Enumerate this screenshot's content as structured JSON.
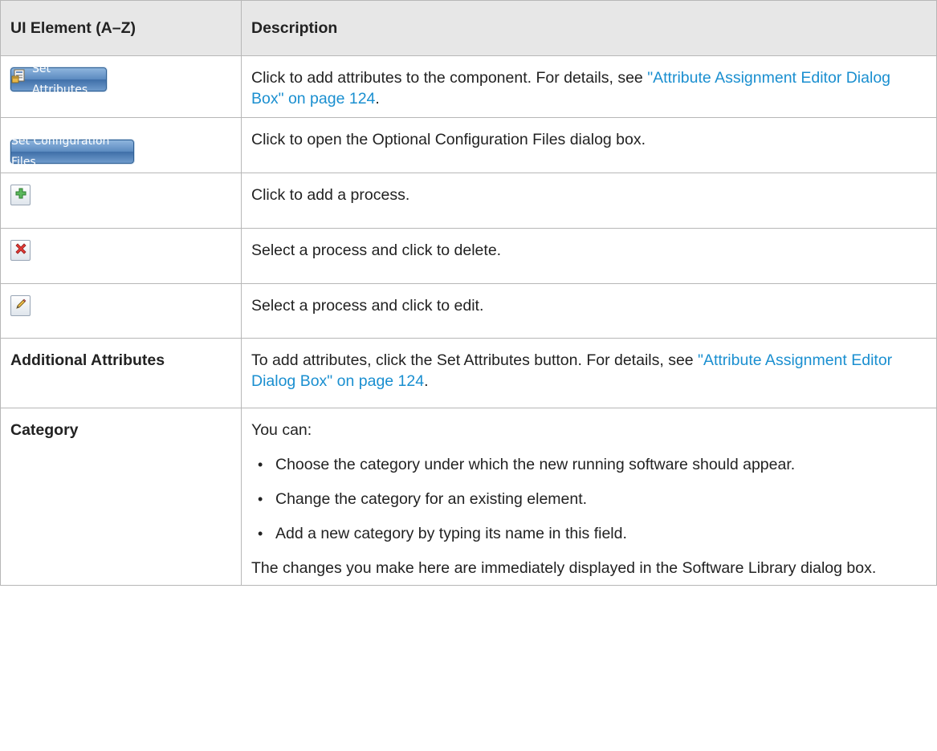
{
  "table": {
    "header": {
      "col1": "UI Element (A–Z)",
      "col2": "Description"
    },
    "rows": {
      "set_attributes": {
        "button_label": "Set Attributes",
        "icon": "set-attributes-icon",
        "desc_prefix": "Click to add attributes to the component. For details, see ",
        "desc_link": "\"Attribute Assignment Editor Dialog Box\" on page 124",
        "desc_suffix": "."
      },
      "set_config": {
        "button_label": "Set Configuration Files",
        "desc": "Click to open the Optional Configuration Files dialog box."
      },
      "add": {
        "icon": "add-plus-icon",
        "desc": "Click to add a process."
      },
      "delete": {
        "icon": "delete-x-icon",
        "desc": "Select a process and click to delete."
      },
      "edit": {
        "icon": "edit-pencil-icon",
        "desc": "Select a process and click to edit."
      },
      "additional": {
        "name": "Additional Attributes",
        "desc_prefix": "To add attributes, click the Set Attributes button. For details, see ",
        "desc_link": "\"Attribute Assignment Editor Dialog Box\" on page 124",
        "desc_suffix": "."
      },
      "category": {
        "name": "Category",
        "intro": "You can:",
        "bullets": [
          "Choose the category under which the new running software should appear.",
          "Change the category for an existing element.",
          "Add a new category by typing its name in this field."
        ],
        "outro": "The changes you make here are immediately displayed in the Software Library dialog box."
      }
    }
  },
  "colors": {
    "link": "#1a8fd0",
    "header_bg": "#e7e7e7",
    "border": "#b7b7b7",
    "button_blue": "#4a7bb4"
  }
}
